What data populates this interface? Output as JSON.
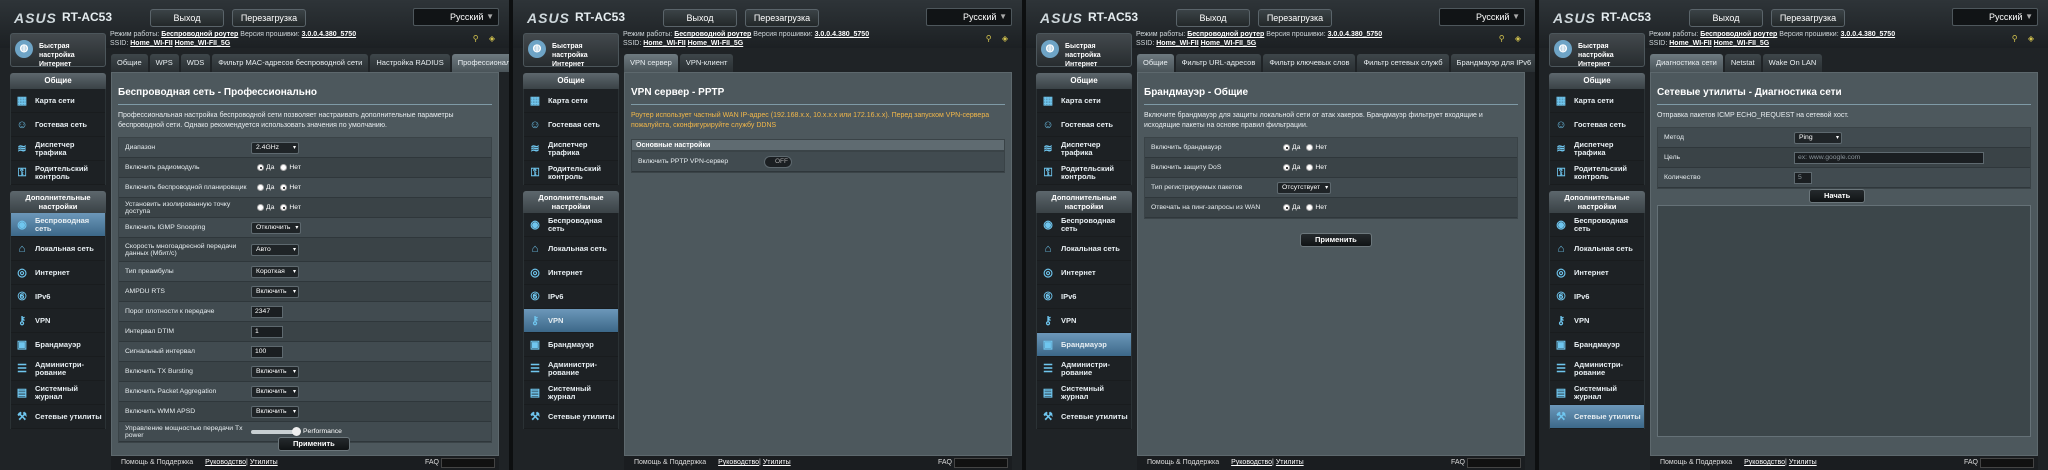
{
  "header": {
    "logo": "ASUS",
    "model": "RT-AC53",
    "logout": "Выход",
    "reboot": "Перезагрузка",
    "language": "Русский",
    "mode_label": "Режим работы:",
    "mode_value": "Беспроводной роутер",
    "fw_label": "Версия прошивки:",
    "fw_value": "3.0.0.4.380_5750",
    "ssid_label": "SSID:",
    "ssid1": "Home_WI-FII",
    "ssid2": "Home_WI-FII_5G"
  },
  "sidebar": {
    "quick": "Быстрая настройка Интернет",
    "general": "Общие",
    "advanced": "Дополнительные настройки",
    "general_items": [
      "Карта сети",
      "Гостевая сеть",
      "Диспетчер трафика",
      "Родительский контроль"
    ],
    "advanced_items": [
      "Беспроводная сеть",
      "Локальная сеть",
      "Интернет",
      "IPv6",
      "VPN",
      "Брандмауэр",
      "Администри-рование",
      "Системный журнал",
      "Сетевые утилиты"
    ]
  },
  "footer": {
    "help": "Помощь & Поддержка",
    "manual": "Руководство",
    "utilities": "Утилиты",
    "faq": "FAQ"
  },
  "pane1": {
    "tabs": [
      "Общие",
      "WPS",
      "WDS",
      "Фильтр MAC-адресов беспроводной сети",
      "Настройка RADIUS",
      "Профессионально"
    ],
    "title": "Беспроводная сеть - Профессионально",
    "desc": "Профессиональная настройка беспроводной сети позволяет настраивать дополнительные параметры беспроводной сети. Однако рекомендуется использовать значения по умолчанию.",
    "yes": "Да",
    "no": "Нет",
    "rows": [
      {
        "label": "Диапазон",
        "value": "2.4GHz"
      },
      {
        "label": "Включить радиомодуль"
      },
      {
        "label": "Включить беспроводной планировщик"
      },
      {
        "label": "Установить изолированную точку доступа"
      },
      {
        "label": "Включить IGMP Snooping",
        "value": "Отключить"
      },
      {
        "label": "Скорость многоадресной передачи данных (Мбит/с)",
        "value": "Авто"
      },
      {
        "label": "Тип преамбулы",
        "value": "Короткая"
      },
      {
        "label": "AMPDU RTS",
        "value": "Включить"
      },
      {
        "label": "Порог плотности к передаче",
        "value": "2347"
      },
      {
        "label": "Интервал DTIM",
        "value": "1"
      },
      {
        "label": "Сигнальный интервал",
        "value": "100"
      },
      {
        "label": "Включить TX Bursting",
        "value": "Включить"
      },
      {
        "label": "Включить Packet Aggregation",
        "value": "Включить"
      },
      {
        "label": "Включить WMM APSD",
        "value": "Включить"
      },
      {
        "label": "Управление мощностью передачи Tx power",
        "value": "Performance"
      }
    ],
    "apply": "Применить"
  },
  "pane2": {
    "tabs": [
      "VPN сервер",
      "VPN-клиент"
    ],
    "title": "VPN сервер - PPTP",
    "warn": "Роутер использует частный WAN IP-адрес (192.168.x.x, 10.x.x.x или 172.16.x.x). Перед запуском VPN-сервера пожалуйста, сконфигурируйте службу DDNS",
    "section": "Основные настройки",
    "row_label": "Включить PPTP VPN-сервер",
    "toggle": "OFF"
  },
  "pane3": {
    "tabs": [
      "Общие",
      "Фильтр URL-адресов",
      "Фильтр ключевых слов",
      "Фильтр сетевых служб",
      "Брандмауэр для IPv6"
    ],
    "title": "Брандмауэр - Общие",
    "desc": "Включите брандмауэр для защиты локальной сети от атак хакеров. Брандмауэр фильтрует входящие и исходящие пакеты на основе правил фильтрации.",
    "yes": "Да",
    "no": "Нет",
    "rows": [
      {
        "label": "Включить брандмауэр"
      },
      {
        "label": "Включить защиту DoS"
      },
      {
        "label": "Тип регистрируемых пакетов",
        "value": "Отсутствует"
      },
      {
        "label": "Отвечать на пинг-запросы из WAN"
      }
    ],
    "apply": "Применить"
  },
  "pane4": {
    "tabs": [
      "Диагностика сети",
      "Netstat",
      "Wake On LAN"
    ],
    "title": "Сетевые утилиты - Диагностика сети",
    "desc": "Отправка пакетов ICMP ECHO_REQUEST на сетевой хост.",
    "rows": [
      {
        "label": "Метод",
        "value": "Ping"
      },
      {
        "label": "Цель",
        "placeholder": "ex: www.google.com"
      },
      {
        "label": "Количество",
        "value": "5"
      }
    ],
    "start": "Начать"
  }
}
